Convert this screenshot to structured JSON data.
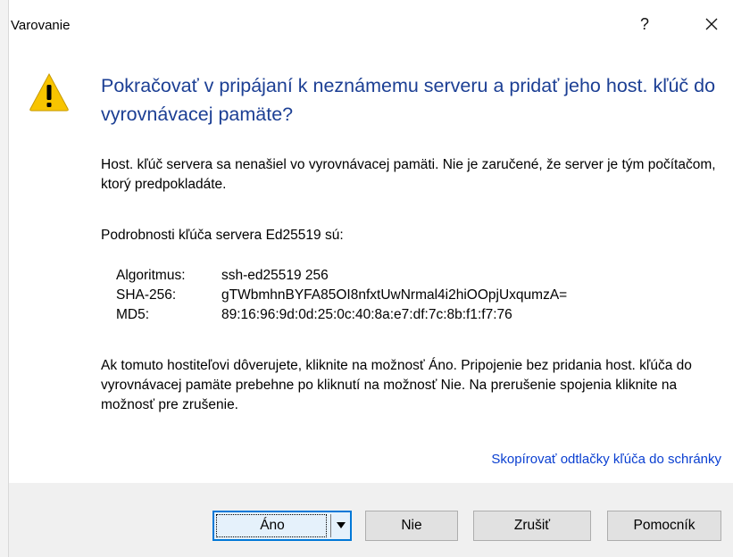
{
  "window": {
    "title": "Varovanie",
    "help_label": "?"
  },
  "icons": {
    "warning": "warning-icon",
    "close": "close-icon",
    "dropdown": "chevron-down-icon"
  },
  "colors": {
    "instruction": "#1c3f94",
    "link": "#0a3fd1",
    "focus_border": "#0078d7",
    "warning_fill": "#f8c400"
  },
  "main": {
    "instruction": "Pokračovať v pripájaní k neznámemu serveru a pridať jeho host. kľúč do vyrovnávacej pamäte?",
    "paragraph1": "Host. kľúč servera sa nenašiel vo vyrovnávacej pamäti. Nie je zaručené, že server je tým počítačom, ktorý predpokladáte.",
    "paragraph2": "Podrobnosti kľúča servera Ed25519 sú:",
    "details": [
      {
        "label": "Algoritmus:",
        "value": "ssh-ed25519 256"
      },
      {
        "label": "SHA-256:",
        "value": "gTWbmhnBYFA85OI8nfxtUwNrmal4i2hiOOpjUxqumzA="
      },
      {
        "label": "MD5:",
        "value": "89:16:96:9d:0d:25:0c:40:8a:e7:df:7c:8b:f1:f7:76"
      }
    ],
    "paragraph3": "Ak tomuto hostiteľovi dôverujete, kliknite na možnosť Áno. Pripojenie bez pridania host. kľúča do vyrovnávacej pamäte prebehne po kliknutí na možnosť Nie. Na prerušenie spojenia kliknite na možnosť pre zrušenie.",
    "copy_link": "Skopírovať odtlačky kľúča do schránky"
  },
  "buttons": {
    "yes": "Áno",
    "no": "Nie",
    "cancel": "Zrušiť",
    "help": "Pomocník"
  }
}
